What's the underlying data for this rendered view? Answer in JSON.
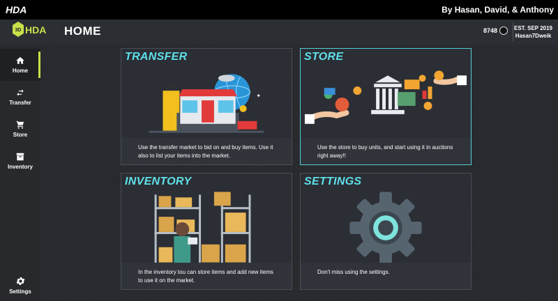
{
  "app": {
    "title": "HDA",
    "credits": "By Hasan, David, & Anthony"
  },
  "header": {
    "page_title": "HOME",
    "balance": "8748",
    "est": "EST. SEP 2019",
    "username": "Hasan7Dweik",
    "logo_text": "HDA",
    "logo_badge": "3D"
  },
  "sidebar": {
    "items": [
      {
        "label": "Home",
        "icon": "home-icon",
        "active": true
      },
      {
        "label": "Transfer",
        "icon": "transfer-icon"
      },
      {
        "label": "Store",
        "icon": "cart-icon"
      },
      {
        "label": "Inventory",
        "icon": "archive-icon"
      },
      {
        "label": "Settings",
        "icon": "gear-icon"
      }
    ]
  },
  "cards": [
    {
      "title": "TRANSFER",
      "description": "Use the transfer market to bid on and buy items. Use it also to list your items into the market."
    },
    {
      "title": "STORE",
      "description": "Use the store to buy units, and start using it in auctions right away!!"
    },
    {
      "title": "INVENTORY",
      "description": "In the inventory tou can store items and add new items to use it on the market."
    },
    {
      "title": "SETTINGS",
      "description": "Don't miss using the settings."
    }
  ],
  "colors": {
    "accent": "#5fe0ea",
    "active_indicator": "#c8e04a",
    "background": "#1f2226"
  }
}
